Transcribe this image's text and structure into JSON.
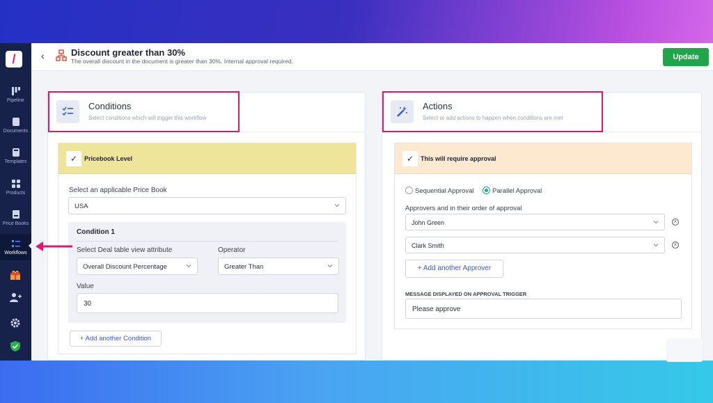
{
  "sidebar": {
    "logo": "/",
    "items": [
      {
        "label": "Pipeline",
        "icon": "pipeline-icon"
      },
      {
        "label": "Documents",
        "icon": "documents-icon"
      },
      {
        "label": "Templates",
        "icon": "templates-icon"
      },
      {
        "label": "Products",
        "icon": "products-icon"
      },
      {
        "label": "Price Books",
        "icon": "price-books-icon"
      },
      {
        "label": "Workflows",
        "icon": "workflows-icon"
      }
    ],
    "extra_icons": [
      "gift-icon",
      "add-user-icon",
      "settings-icon",
      "shield-check-icon"
    ]
  },
  "header": {
    "title": "Discount greater than 30%",
    "subtitle": "The overall discount in the document is greater than 30%. Internal approval required.",
    "update_label": "Update"
  },
  "conditions": {
    "title": "Conditions",
    "subtitle": "Select conditions which will trigger this workflow",
    "card_label": "Pricebook Level",
    "pricebook_label": "Select an applicable Price Book",
    "pricebook_value": "USA",
    "condition_title": "Condition 1",
    "attribute_label": "Select Deal table view attribute",
    "attribute_value": "Overall Discount Percentage",
    "operator_label": "Operator",
    "operator_value": "Greater Than",
    "value_label": "Value",
    "value": "30",
    "add_condition_label": "+ Add another Condition"
  },
  "actions": {
    "title": "Actions",
    "subtitle": "Select or add actions to happen when conditions are met",
    "card_label": "This will require approval",
    "sequential_label": "Sequential Approval",
    "parallel_label": "Parallel Approval",
    "selected_mode": "Parallel Approval",
    "approvers_label": "Approvers and in their order of approval",
    "approvers": [
      "John Green",
      "Clark Smith"
    ],
    "add_approver_label": "+ Add another Approver",
    "message_label": "MESSAGE DISPLAYED ON APPROVAL TRIGGER",
    "message_value": "Please approve"
  },
  "colors": {
    "accent_green": "#21a54a",
    "highlight_pink": "#e5166a",
    "sidebar_bg": "#16224a",
    "conditions_band": "#efe59a",
    "actions_band": "#fde9cf",
    "link_blue": "#3b55d9"
  }
}
